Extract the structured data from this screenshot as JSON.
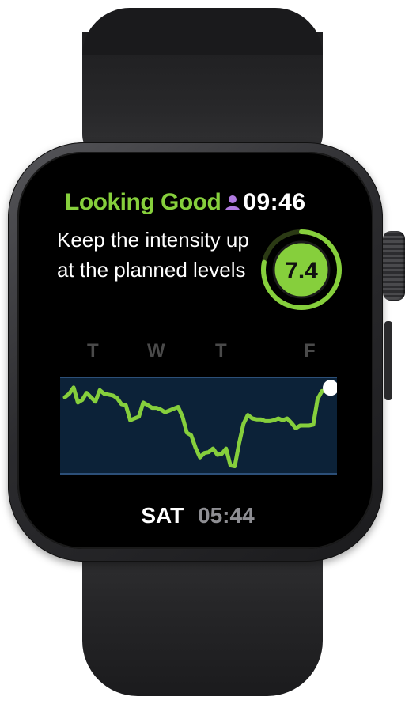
{
  "header": {
    "status_text": "Looking Good",
    "time": "09:46",
    "profile_icon": "person-icon"
  },
  "message": "Keep the intensity up at the planned levels",
  "score": {
    "value": "7.4",
    "ring_fraction": 0.78
  },
  "colors": {
    "accent_green": "#86cf3c",
    "profile_purple": "#b07ae0",
    "chart_band": "#0c2238",
    "chart_band_edge": "#2c4f78"
  },
  "chart_data": {
    "type": "line",
    "day_labels": [
      "T",
      "W",
      "T",
      "F"
    ],
    "y": [
      0.82,
      0.86,
      0.93,
      0.76,
      0.79,
      0.87,
      0.82,
      0.77,
      0.9,
      0.86,
      0.85,
      0.84,
      0.81,
      0.74,
      0.73,
      0.56,
      0.58,
      0.6,
      0.76,
      0.73,
      0.7,
      0.7,
      0.68,
      0.65,
      0.67,
      0.69,
      0.71,
      0.6,
      0.42,
      0.39,
      0.25,
      0.14,
      0.19,
      0.2,
      0.24,
      0.17,
      0.18,
      0.24,
      0.05,
      0.04,
      0.3,
      0.52,
      0.62,
      0.58,
      0.57,
      0.57,
      0.55,
      0.55,
      0.56,
      0.58,
      0.56,
      0.58,
      0.53,
      0.47,
      0.5,
      0.5,
      0.5,
      0.51,
      0.8,
      0.89,
      0.89,
      0.89
    ],
    "series": [
      {
        "values": []
      }
    ]
  },
  "footer": {
    "day": "SAT",
    "time": "05:44"
  }
}
